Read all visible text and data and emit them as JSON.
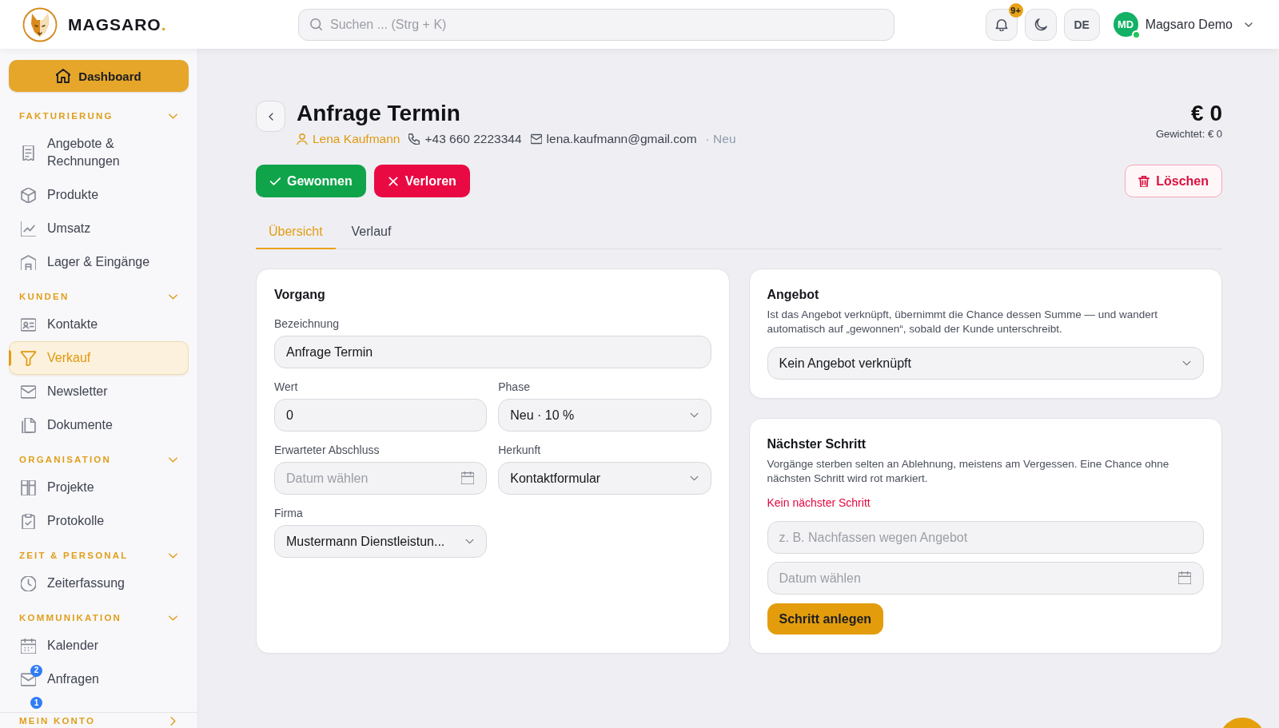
{
  "header": {
    "logo": {
      "name": "MAGSARO",
      "suffix": "."
    },
    "search": {
      "placeholder": "Suchen ... (Strg + K)"
    },
    "notifications": {
      "badge": "9+"
    },
    "language": "DE",
    "user": {
      "initials": "MD",
      "name": "Magsaro Demo",
      "online": true
    }
  },
  "sidebar": {
    "dashboard": "Dashboard",
    "sections": [
      {
        "title": "FAKTURIERUNG",
        "expanded": true,
        "items": [
          {
            "label": "Angebote & Rechnungen",
            "selected": false
          },
          {
            "label": "Produkte",
            "selected": false
          },
          {
            "label": "Umsatz",
            "selected": false
          },
          {
            "label": "Lager & Eingänge",
            "selected": false
          }
        ]
      },
      {
        "title": "KUNDEN",
        "expanded": true,
        "items": [
          {
            "label": "Kontakte",
            "selected": false
          },
          {
            "label": "Verkauf",
            "selected": true
          },
          {
            "label": "Newsletter",
            "selected": false
          },
          {
            "label": "Dokumente",
            "selected": false
          }
        ]
      },
      {
        "title": "ORGANISATION",
        "expanded": true,
        "items": [
          {
            "label": "Projekte",
            "selected": false
          },
          {
            "label": "Protokolle",
            "selected": false
          }
        ]
      },
      {
        "title": "ZEIT & PERSONAL",
        "expanded": true,
        "items": [
          {
            "label": "Zeiterfassung",
            "selected": false
          }
        ]
      },
      {
        "title": "KOMMUNIKATION",
        "expanded": true,
        "items": [
          {
            "label": "Kalender",
            "selected": false
          },
          {
            "label": "Anfragen",
            "selected": false,
            "badge": "2"
          }
        ]
      }
    ],
    "overflow_badge": "1",
    "footer": {
      "title": "MEIN KONTO",
      "expanded": false
    }
  },
  "deal": {
    "title": "Anfrage Termin",
    "contact": {
      "name": "Lena Kaufmann",
      "phone": "+43 660 2223344",
      "email": "lena.kaufmann@gmail.com"
    },
    "status": "· Neu",
    "amount": "€ 0",
    "weighted": "Gewichtet: € 0"
  },
  "actions": [
    {
      "label": "Gewonnen",
      "kind": "won"
    },
    {
      "label": "Verloren",
      "kind": "lost"
    },
    {
      "label": "Löschen",
      "kind": "delete"
    }
  ],
  "tabs": [
    {
      "label": "Übersicht",
      "selected": true
    },
    {
      "label": "Verlauf",
      "selected": false
    }
  ],
  "vorgang": {
    "title": "Vorgang",
    "main_field": {
      "label": "Bezeichnung",
      "kind": "text",
      "value": "Anfrage Termin"
    },
    "fields": [
      {
        "label": "Wert",
        "kind": "text",
        "value": "0"
      },
      {
        "label": "Phase",
        "kind": "select",
        "value": "Neu · 10 %"
      },
      {
        "label": "Erwarteter Abschluss",
        "kind": "date",
        "placeholder": "Datum wählen"
      },
      {
        "label": "Herkunft",
        "kind": "select",
        "value": "Kontaktformular"
      },
      {
        "label": "Firma",
        "kind": "select",
        "value": "Mustermann Dienstleistun..."
      }
    ]
  },
  "angebot": {
    "title": "Angebot",
    "description": "Ist das Angebot verknüpft, übernimmt die Chance dessen Summe — und wandert automatisch auf „gewonnen“, sobald der Kunde unterschreibt.",
    "field": {
      "kind": "select",
      "value": "Kein Angebot verknüpft"
    }
  },
  "next_step": {
    "title": "Nächster Schritt",
    "description": "Vorgänge sterben selten an Ablehnung, meistens am Vergessen. Eine Chance ohne nächsten Schritt wird rot markiert.",
    "warning": "Kein nächster Schritt",
    "fields": [
      {
        "kind": "text",
        "placeholder": "z. B. Nachfassen wegen Angebot"
      },
      {
        "kind": "date",
        "placeholder": "Datum wählen"
      }
    ],
    "button": "Schritt anlegen"
  }
}
